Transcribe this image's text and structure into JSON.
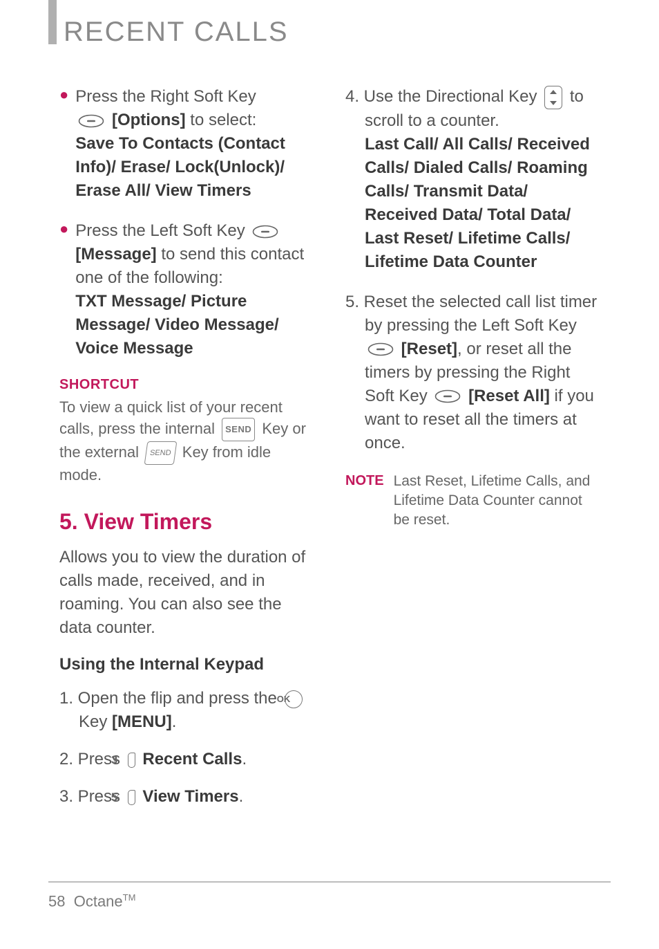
{
  "page_title": "RECENT CALLS",
  "left": {
    "bullet1": {
      "line1a": "Press the Right Soft Key",
      "line1b_label": "[Options]",
      "line1b_tail": " to select:",
      "options": "Save To Contacts (Contact Info)/ Erase/ Lock(Unlock)/ Erase All/ View Timers"
    },
    "bullet2": {
      "line1": "Press the Left Soft Key ",
      "label": "[Message]",
      "line2": " to send this contact one of the following:",
      "options": "TXT Message/ Picture Message/ Video Message/ Voice Message"
    },
    "shortcut": {
      "heading": "SHORTCUT",
      "body_a": "To view a quick list of your recent calls, press the internal ",
      "send": "SEND",
      "body_b": " Key or the external ",
      "ext": "SEND",
      "body_c": " Key from idle mode."
    },
    "section5": {
      "title": "5. View Timers",
      "intro": "Allows you to view the duration of calls made, received, and in roaming. You can also see the data counter.",
      "subhead": "Using the Internal Keypad",
      "step1_a": "1. Open the flip and press the ",
      "ok": "OK",
      "step1_b": "Key ",
      "step1_menu": "[MENU]",
      "step1_c": ".",
      "step2_a": "2. Press ",
      "key3": "3",
      "key3sup": "#",
      "step2_b": "Recent Calls",
      "step2_c": ".",
      "step3_a": "3. Press ",
      "key5": "5",
      "key5sup": "%",
      "step3_b": "View Timers",
      "step3_c": "."
    }
  },
  "right": {
    "step4_a": "4. Use the Directional Key ",
    "step4_b": " to scroll to a counter.",
    "step4_opts": "Last Call/ All Calls/ Received Calls/ Dialed Calls/ Roaming Calls/ Transmit Data/ Received Data/ Total Data/ Last Reset/ Lifetime Calls/ Lifetime Data Counter",
    "step5_a": "5. Reset the selected call list timer by pressing the Left Soft Key ",
    "step5_reset": "[Reset]",
    "step5_b": ", or reset all the timers by pressing the Right Soft Key ",
    "step5_resetall": "[Reset All]",
    "step5_c": " if you want to reset all the timers at once.",
    "note_label": "NOTE",
    "note_body": "Last Reset, Lifetime Calls, and Lifetime Data Counter cannot be reset."
  },
  "footer": {
    "page_no": "58",
    "product": "Octane",
    "tm": "TM"
  }
}
